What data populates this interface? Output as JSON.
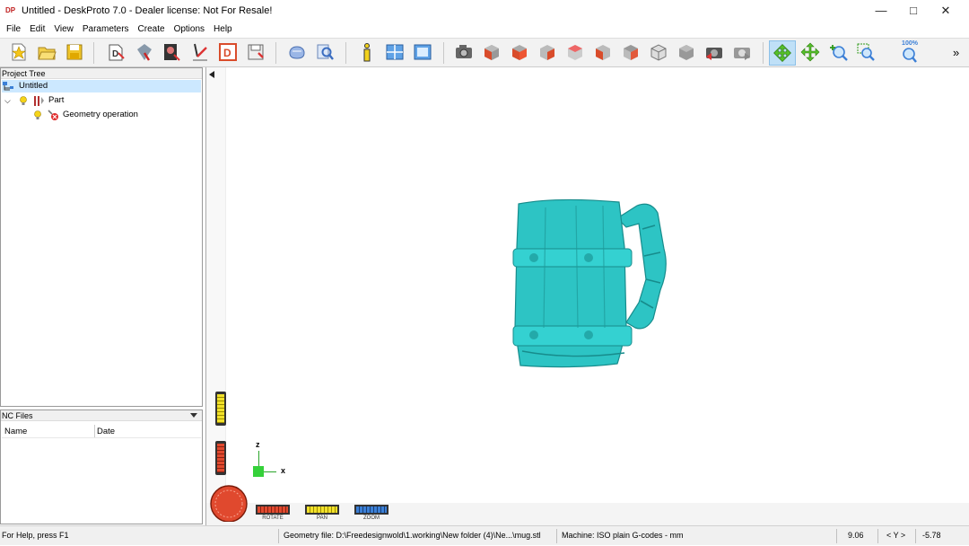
{
  "window": {
    "title": "Untitled - DeskProto 7.0 - Dealer license: Not For Resale!",
    "logo": "DP",
    "minimize_glyph": "—",
    "maximize_glyph": "□",
    "close_glyph": "✕"
  },
  "menu": [
    "File",
    "Edit",
    "View",
    "Parameters",
    "Create",
    "Options",
    "Help"
  ],
  "toolbar": {
    "overflow_glyph": "»",
    "zoom_100_label": "100%"
  },
  "project_tree": {
    "header": "Project Tree",
    "root": "Untitled",
    "part": "Part",
    "operation": "Geometry operation"
  },
  "nc_files": {
    "header": "NC Files",
    "col_name": "Name",
    "col_date": "Date"
  },
  "viewport": {
    "axis_z": "z",
    "axis_x": "x",
    "rotate_label": "ROTATE",
    "pan_label": "PAN",
    "zoom_label": "ZOOM",
    "model_color": "#2dc4c4"
  },
  "status": {
    "help": "For Help, press F1",
    "geometry_file": "Geometry file: D:\\Freedesignwold\\1.working\\New folder (4)\\Ne...\\mug.stl",
    "machine": "Machine: ISO plain G-codes - mm",
    "x_value": "9.06",
    "axis_pair": "< Y >",
    "y_value": "-5.78"
  },
  "colors": {
    "selection": "#cce8ff",
    "accent_red": "#d9412b",
    "accent_yellow": "#e8d21a",
    "accent_blue": "#3b7fd6",
    "active_nav": "#bfe0f7"
  }
}
